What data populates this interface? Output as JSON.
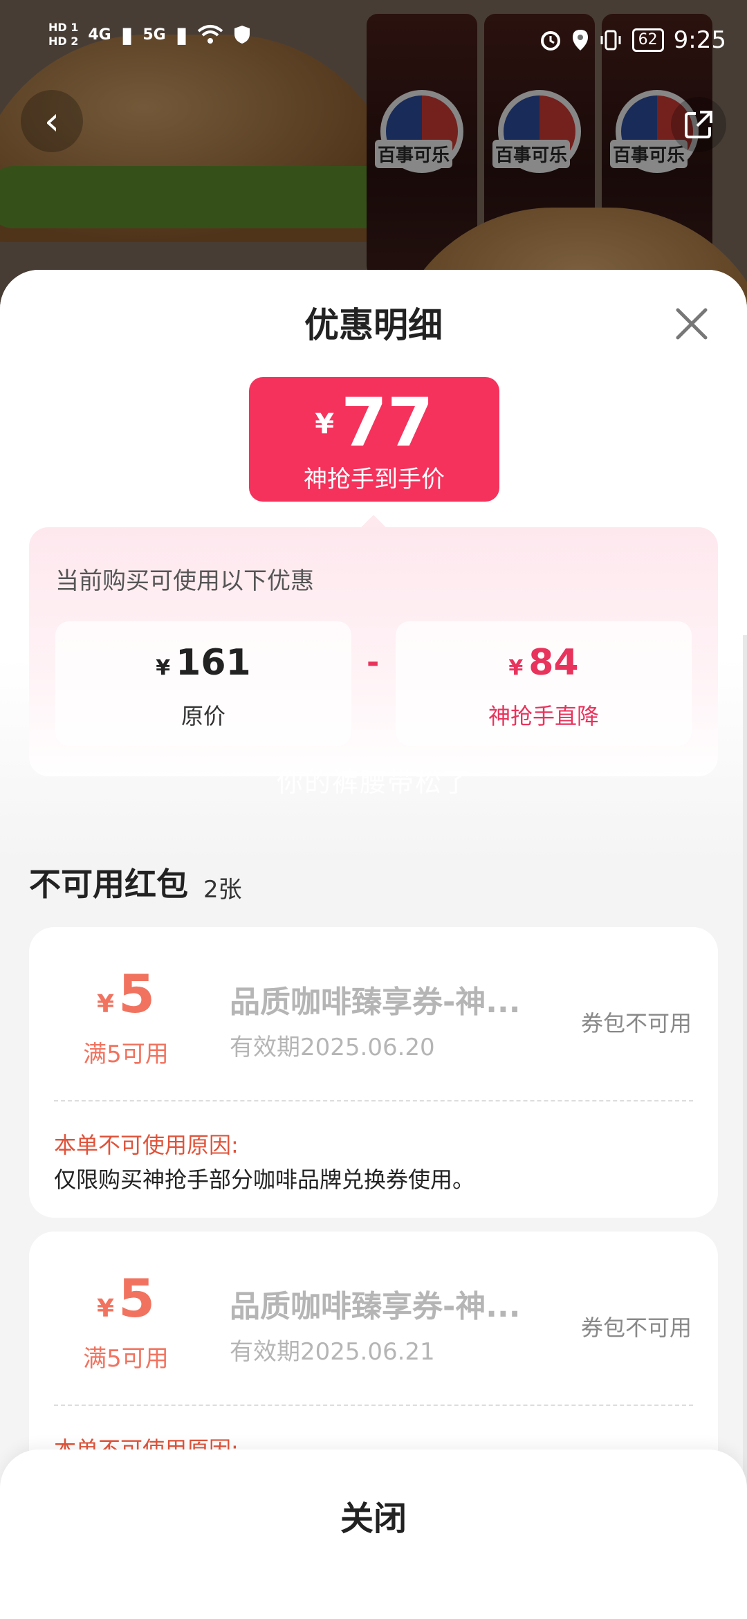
{
  "status_bar": {
    "hd1": "HD 1",
    "hd2": "HD 2",
    "net1": "4G",
    "net2": "5G",
    "battery": "62",
    "time": "9:25"
  },
  "hero": {
    "can_logo_text": "百事可乐"
  },
  "sheet": {
    "title": "优惠明细",
    "final_price": {
      "currency": "¥",
      "amount": "77",
      "label": "神抢手到手价"
    },
    "discounts": {
      "hint": "当前购买可使用以下优惠",
      "original": {
        "currency": "¥",
        "amount": "161",
        "label": "原价"
      },
      "operator": "-",
      "reduction": {
        "currency": "¥",
        "amount": "84",
        "label": "神抢手直降"
      }
    },
    "watermark": "你的裤腰带松了",
    "unusable": {
      "title": "不可用红包",
      "count": "2张",
      "coupons": [
        {
          "currency": "¥",
          "value": "5",
          "condition": "满5可用",
          "name": "品质咖啡臻享券-神...",
          "expiry": "有效期2025.06.20",
          "state": "券包不可用",
          "reason_title": "本单不可使用原因:",
          "reason": "仅限购买神抢手部分咖啡品牌兑换券使用。"
        },
        {
          "currency": "¥",
          "value": "5",
          "condition": "满5可用",
          "name": "品质咖啡臻享券-神...",
          "expiry": "有效期2025.06.21",
          "state": "券包不可用",
          "reason_title": "本单不可使用原因:",
          "reason": ""
        }
      ]
    },
    "close_label": "关闭"
  },
  "colors": {
    "accent": "#f5325c",
    "coupon_value": "#f1735f",
    "reason_title": "#e0533a"
  }
}
